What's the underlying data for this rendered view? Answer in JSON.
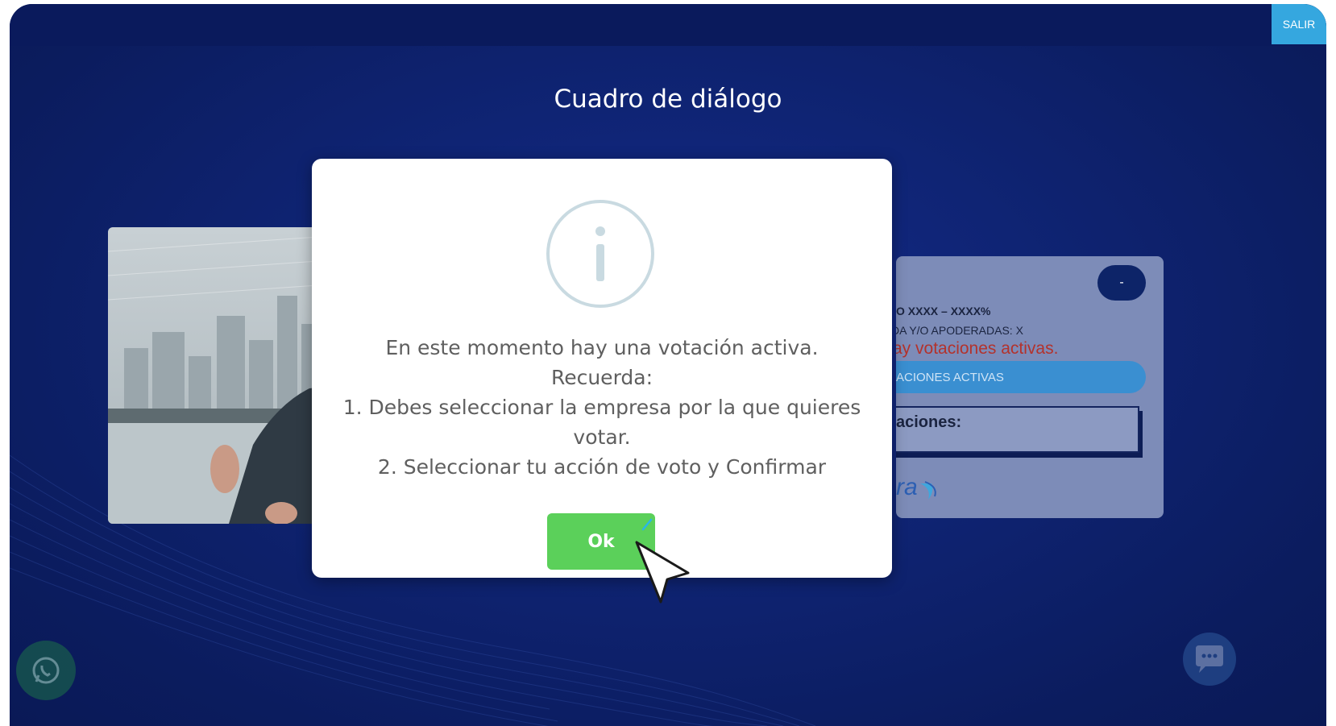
{
  "header": {
    "exit_label": "SALIR"
  },
  "page": {
    "title": "Cuadro de diálogo"
  },
  "background_card": {
    "collapse_label": "-",
    "percentage_line": "O XXXX – XXXX%",
    "proxies_line": "DA Y/O APODERADAS: X",
    "status_line": "ay votaciones activas.",
    "active_votes_button": "ACIONES ACTIVAS",
    "votes_label": "aciones:",
    "logo_fragment": "ra"
  },
  "dialog": {
    "icon": "info-icon",
    "lines": [
      "En este momento hay una votación activa.",
      "Recuerda:",
      "1. Debes seleccionar la empresa por la que quieres",
      "votar.",
      "2. Seleccionar tu acción de voto y Confirmar"
    ],
    "ok_label": "Ok"
  },
  "floating": {
    "whatsapp_icon": "whatsapp-icon",
    "chat_icon": "chat-bot-icon"
  },
  "colors": {
    "background": "#0f2474",
    "exit_button": "#35a7df",
    "ok_button": "#5bd05a",
    "status_text": "#b3322c",
    "active_button": "#3a8fd1"
  }
}
